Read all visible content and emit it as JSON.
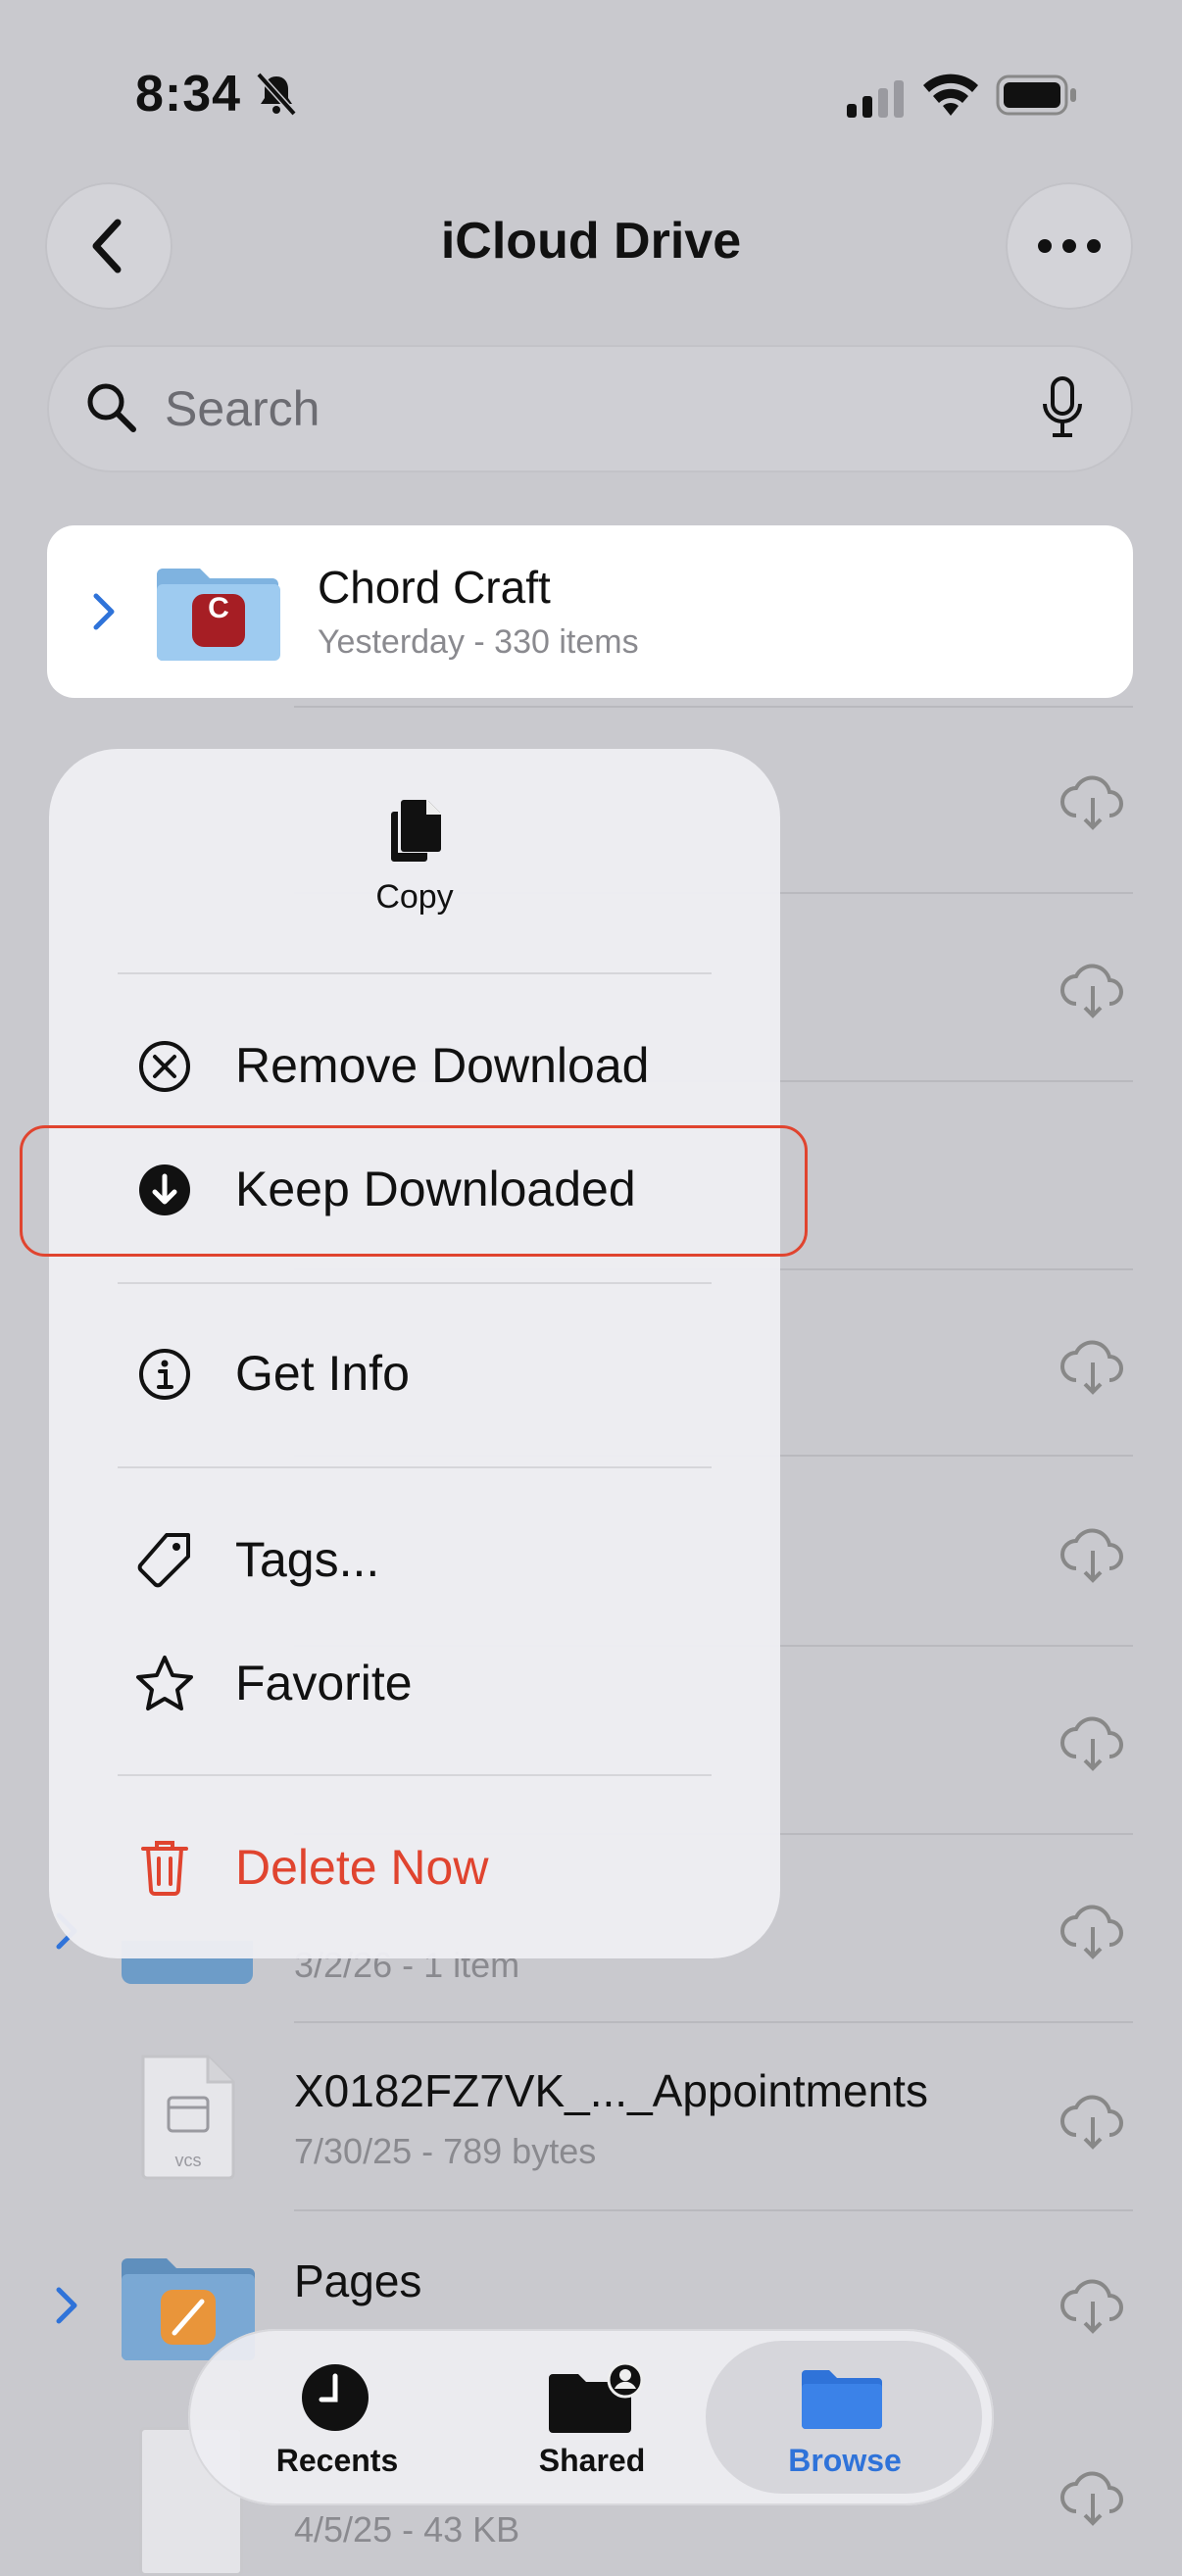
{
  "status_bar": {
    "time": "8:34"
  },
  "header": {
    "title": "iCloud Drive"
  },
  "search": {
    "placeholder": "Search"
  },
  "selected_folder": {
    "name": "Chord Craft",
    "detail": "Yesterday - 330 items",
    "badge": "C"
  },
  "list": [
    {
      "name": "X0182FZ7VK_..._Appointments",
      "detail": "7/30/25 - 789 bytes",
      "file_badge": "vcs"
    },
    {
      "name": "Pages",
      "detail": ""
    },
    {
      "name": "",
      "detail": "4/5/25 - 43 KB"
    }
  ],
  "partial_row_detail": "3/2/26 - 1 item",
  "context_menu": {
    "copy": "Copy",
    "remove_download": "Remove Download",
    "keep_downloaded": "Keep Downloaded",
    "get_info": "Get Info",
    "tags": "Tags...",
    "favorite": "Favorite",
    "delete_now": "Delete Now"
  },
  "tab_bar": {
    "recents": "Recents",
    "shared": "Shared",
    "browse": "Browse"
  },
  "colors": {
    "accent": "#2f73d9",
    "destructive": "#e0442f",
    "highlight": "#e0442f"
  }
}
